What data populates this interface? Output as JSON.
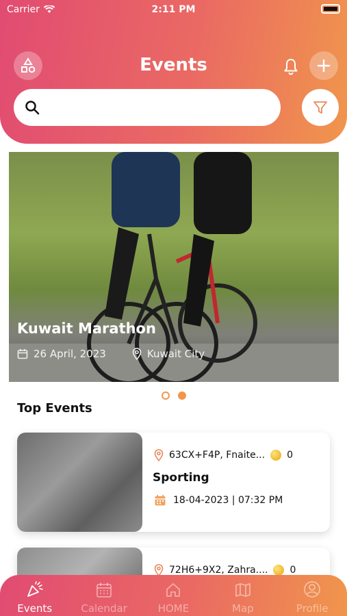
{
  "status_bar": {
    "carrier": "Carrier",
    "time": "2:11 PM"
  },
  "header": {
    "title": "Events"
  },
  "search": {
    "placeholder": ""
  },
  "featured": [
    {
      "title": "Kuwait Marathon",
      "date": "26 April, 2023",
      "location": "Kuwait City"
    }
  ],
  "carousel": {
    "count": 2,
    "active_index": 1
  },
  "top_events": {
    "heading": "Top Events",
    "items": [
      {
        "location": "63CX+F4P, Fnaite...",
        "coins": "0",
        "title": "Sporting",
        "datetime": "18-04-2023 | 07:32 PM"
      },
      {
        "location": "72H6+9X2, Zahra....",
        "coins": "0"
      }
    ]
  },
  "tabs": [
    {
      "label": "Events",
      "icon": "party-popper-icon",
      "active": true
    },
    {
      "label": "Calendar",
      "icon": "calendar-icon",
      "active": false
    },
    {
      "label": "HOME",
      "icon": "home-icon",
      "active": false
    },
    {
      "label": "Map",
      "icon": "map-icon",
      "active": false
    },
    {
      "label": "Profile",
      "icon": "user-icon",
      "active": false
    }
  ],
  "colors": {
    "gradient_start": "#e14b72",
    "gradient_end": "#f0964c",
    "accent": "#f0964c"
  }
}
